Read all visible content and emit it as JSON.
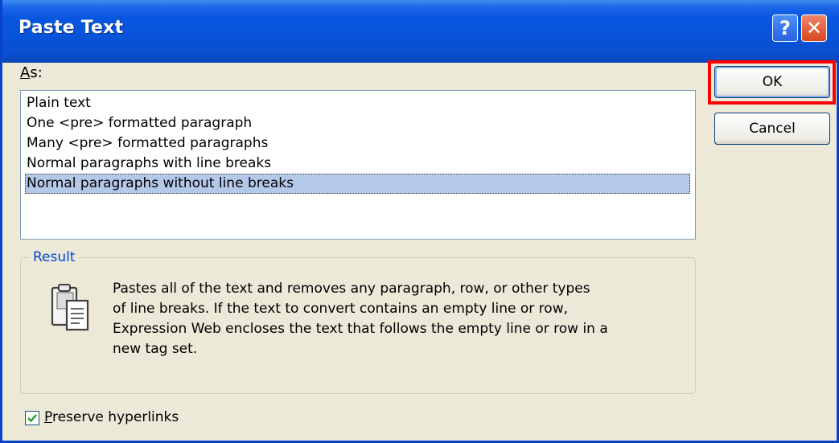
{
  "dialog": {
    "title": "Paste Text",
    "help_label": "?",
    "close_label": "✕"
  },
  "as_section": {
    "label_accelerator": "A",
    "label_rest": "s:",
    "items": [
      {
        "label": "Plain text",
        "selected": false
      },
      {
        "label": "One <pre> formatted paragraph",
        "selected": false
      },
      {
        "label": "Many <pre> formatted paragraphs",
        "selected": false
      },
      {
        "label": "Normal paragraphs with line breaks",
        "selected": false
      },
      {
        "label": "Normal paragraphs without line breaks",
        "selected": true
      }
    ]
  },
  "result": {
    "label": "Result",
    "icon": "clipboard-paste-icon",
    "description_lines": [
      "Pastes all of the text and removes any paragraph, row, or other types",
      "of line breaks. If the text to convert contains an empty line or row,",
      "Expression Web encloses the text that follows the empty line or row in a",
      "new tag set."
    ]
  },
  "preserve_hyperlinks": {
    "checked": true,
    "label_accelerator": "P",
    "label_rest": "reserve hyperlinks"
  },
  "buttons": {
    "ok_label": "OK",
    "cancel_label": "Cancel"
  },
  "colors": {
    "titlebar": "#0853d8",
    "selection": "#b4c8ea",
    "highlight": "#ff0000",
    "group_title": "#0046d5"
  }
}
